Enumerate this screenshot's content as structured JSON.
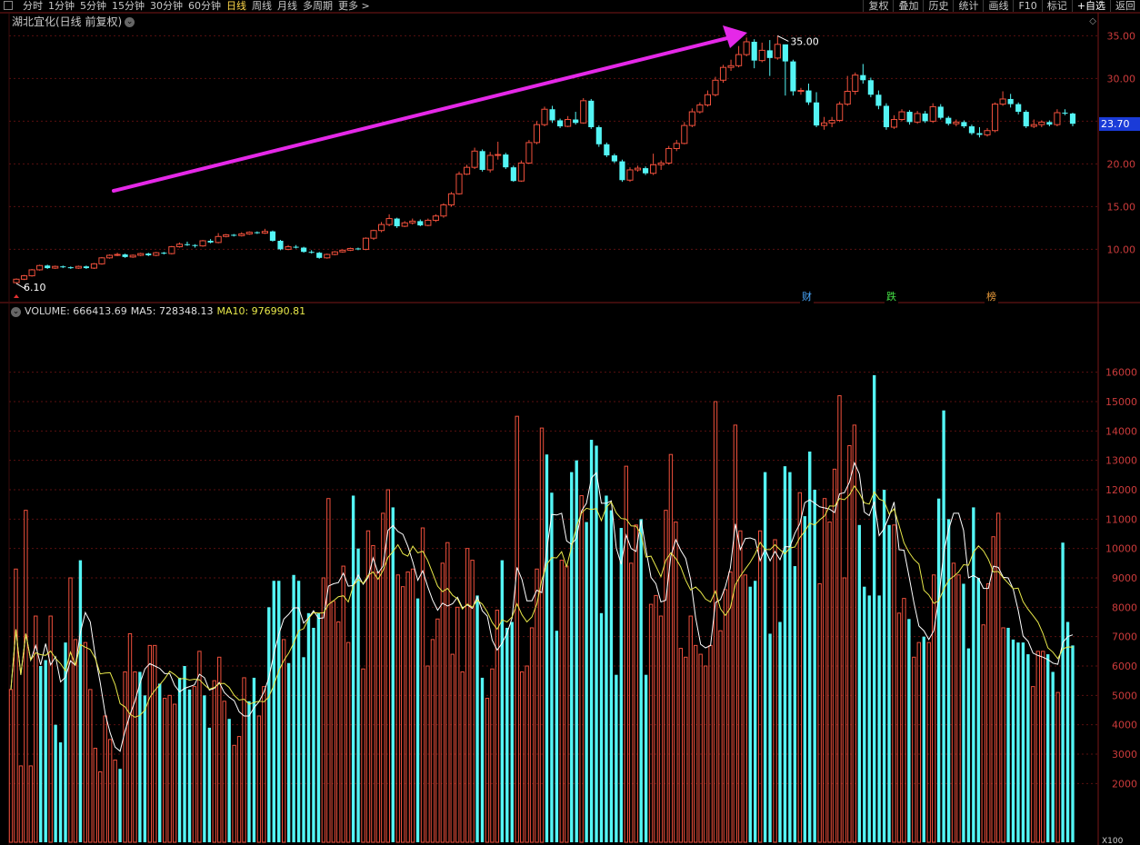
{
  "toolbar": {
    "periods": [
      "分时",
      "1分钟",
      "5分钟",
      "15分钟",
      "30分钟",
      "60分钟",
      "日线",
      "周线",
      "月线",
      "多周期",
      "更多 >"
    ],
    "active_period": "日线",
    "actions": [
      "复权",
      "叠加",
      "历史",
      "统计",
      "画线",
      "F10",
      "标记",
      "+自选",
      "返回"
    ],
    "highlight_action": "+自选"
  },
  "chart_title": "湖北宜化(日线 前复权)",
  "price_axis": {
    "ticks": [
      "35.00",
      "30.00",
      "25.00",
      "20.00",
      "15.00",
      "10.00"
    ],
    "values": [
      35,
      30,
      25,
      20,
      15,
      10
    ]
  },
  "volume_axis": {
    "ticks": [
      "16000",
      "15000",
      "14000",
      "13000",
      "12000",
      "11000",
      "10000",
      "9000",
      "8000",
      "7000",
      "6000",
      "5000",
      "4000",
      "3000",
      "2000"
    ],
    "values": [
      16000,
      15000,
      14000,
      13000,
      12000,
      11000,
      10000,
      9000,
      8000,
      7000,
      6000,
      5000,
      4000,
      3000,
      2000
    ],
    "unit_label": "X100"
  },
  "volume_header": {
    "volume": "VOLUME: 666413.69",
    "ma5": "MA5: 728348.13",
    "ma10": "MA10: 976990.81"
  },
  "last_price": "23.70",
  "high_label": "35.00",
  "low_label": "6.10",
  "events": [
    {
      "label": "财",
      "color": "#4aa8ff"
    },
    {
      "label": "跌",
      "color": "#45e045"
    },
    {
      "label": "榜",
      "color": "#e89a3a"
    }
  ],
  "colors": {
    "up": "#f0503c",
    "down": "#54f5f5",
    "ma5": "#ffffff",
    "ma10": "#e8e84a",
    "grid": "#5a1010",
    "arrow": "#e528e8",
    "axis_text": "#cc3b3b"
  },
  "chart_data": [
    {
      "type": "candlestick",
      "ylim": [
        6,
        36
      ],
      "candles": [
        [
          6.1,
          6.5,
          6.0,
          6.6
        ],
        [
          6.5,
          6.9,
          6.4,
          7.0
        ],
        [
          6.9,
          7.6,
          6.8,
          7.7
        ],
        [
          7.6,
          8.1,
          7.5,
          8.2
        ],
        [
          8.1,
          7.8,
          7.7,
          8.2
        ],
        [
          7.8,
          8.0,
          7.7,
          8.1
        ],
        [
          8.0,
          7.9,
          7.8,
          8.1
        ],
        [
          7.9,
          7.8,
          7.7,
          8.0
        ],
        [
          7.8,
          8.0,
          7.7,
          8.1
        ],
        [
          8.0,
          7.8,
          7.7,
          8.1
        ],
        [
          7.8,
          8.3,
          7.7,
          8.4
        ],
        [
          8.3,
          9.0,
          8.2,
          9.1
        ],
        [
          9.0,
          9.3,
          8.9,
          9.4
        ],
        [
          9.3,
          9.4,
          9.2,
          9.6
        ],
        [
          9.4,
          9.1,
          9.0,
          9.5
        ],
        [
          9.1,
          9.3,
          9.0,
          9.4
        ],
        [
          9.3,
          9.5,
          9.2,
          9.6
        ],
        [
          9.5,
          9.3,
          9.2,
          9.6
        ],
        [
          9.3,
          9.6,
          9.2,
          9.7
        ],
        [
          9.6,
          9.5,
          9.4,
          9.7
        ],
        [
          9.5,
          10.3,
          9.4,
          10.4
        ],
        [
          10.3,
          10.6,
          10.2,
          10.8
        ],
        [
          10.6,
          10.5,
          10.4,
          10.9
        ],
        [
          10.5,
          10.4,
          10.2,
          10.6
        ],
        [
          10.4,
          11.0,
          10.3,
          11.1
        ],
        [
          11.0,
          10.8,
          10.7,
          11.2
        ],
        [
          10.8,
          11.5,
          10.7,
          11.9
        ],
        [
          11.5,
          11.7,
          11.4,
          11.8
        ],
        [
          11.7,
          11.6,
          11.5,
          11.8
        ],
        [
          11.6,
          11.8,
          11.5,
          12.0
        ],
        [
          11.8,
          12.0,
          11.7,
          12.1
        ],
        [
          12.0,
          11.9,
          11.8,
          12.1
        ],
        [
          11.9,
          12.1,
          11.8,
          12.4
        ],
        [
          12.1,
          11.0,
          10.9,
          12.2
        ],
        [
          11.0,
          10.0,
          9.9,
          11.1
        ],
        [
          10.0,
          10.3,
          9.9,
          10.5
        ],
        [
          10.3,
          10.2,
          10.1,
          10.5
        ],
        [
          10.2,
          9.7,
          9.6,
          10.3
        ],
        [
          9.7,
          9.6,
          9.5,
          9.9
        ],
        [
          9.6,
          9.0,
          8.9,
          9.7
        ],
        [
          9.0,
          9.4,
          8.9,
          9.5
        ],
        [
          9.4,
          9.7,
          9.3,
          9.8
        ],
        [
          9.7,
          9.9,
          9.6,
          10.0
        ],
        [
          9.9,
          10.1,
          9.8,
          10.2
        ],
        [
          10.1,
          10.0,
          9.9,
          10.2
        ],
        [
          10.0,
          11.3,
          9.9,
          11.4
        ],
        [
          11.3,
          12.2,
          11.1,
          12.3
        ],
        [
          12.2,
          12.9,
          12.0,
          13.2
        ],
        [
          12.9,
          13.6,
          12.7,
          14.1
        ],
        [
          13.6,
          12.7,
          12.5,
          13.7
        ],
        [
          12.7,
          13.1,
          12.6,
          13.3
        ],
        [
          13.1,
          13.3,
          12.9,
          13.6
        ],
        [
          13.3,
          12.8,
          12.7,
          13.5
        ],
        [
          12.8,
          13.4,
          12.7,
          13.6
        ],
        [
          13.4,
          13.9,
          13.2,
          14.1
        ],
        [
          13.9,
          15.2,
          13.7,
          15.4
        ],
        [
          15.2,
          16.5,
          15.0,
          16.7
        ],
        [
          16.5,
          18.8,
          16.4,
          19.1
        ],
        [
          18.8,
          19.6,
          18.7,
          19.9
        ],
        [
          19.6,
          21.5,
          19.4,
          21.9
        ],
        [
          21.5,
          19.3,
          19.1,
          21.7
        ],
        [
          19.3,
          21.0,
          19.0,
          21.4
        ],
        [
          21.0,
          21.1,
          20.5,
          22.6
        ],
        [
          21.1,
          19.6,
          19.4,
          21.3
        ],
        [
          19.6,
          18.0,
          17.9,
          19.8
        ],
        [
          18.0,
          20.1,
          17.9,
          20.4
        ],
        [
          20.1,
          22.5,
          20.0,
          22.8
        ],
        [
          22.5,
          24.6,
          22.3,
          25.0
        ],
        [
          24.6,
          26.4,
          24.4,
          26.7
        ],
        [
          26.4,
          25.1,
          24.8,
          26.8
        ],
        [
          25.1,
          24.4,
          24.2,
          25.3
        ],
        [
          24.4,
          25.2,
          24.3,
          25.6
        ],
        [
          25.2,
          24.8,
          24.6,
          26.1
        ],
        [
          24.8,
          27.4,
          24.7,
          27.7
        ],
        [
          27.4,
          24.3,
          24.1,
          27.6
        ],
        [
          24.3,
          22.3,
          22.0,
          24.5
        ],
        [
          22.3,
          21.0,
          20.8,
          22.5
        ],
        [
          21.0,
          20.3,
          20.1,
          21.2
        ],
        [
          20.3,
          18.1,
          17.9,
          20.5
        ],
        [
          18.1,
          19.3,
          17.9,
          19.6
        ],
        [
          19.3,
          19.5,
          19.1,
          19.8
        ],
        [
          19.5,
          18.9,
          18.7,
          19.7
        ],
        [
          18.9,
          19.9,
          18.7,
          21.2
        ],
        [
          19.9,
          20.1,
          19.3,
          20.4
        ],
        [
          20.1,
          21.8,
          19.9,
          22.1
        ],
        [
          21.8,
          22.4,
          21.5,
          22.8
        ],
        [
          22.4,
          24.5,
          22.3,
          24.9
        ],
        [
          24.5,
          26.1,
          24.3,
          26.5
        ],
        [
          26.1,
          26.9,
          25.9,
          27.2
        ],
        [
          26.9,
          28.1,
          26.7,
          28.6
        ],
        [
          28.1,
          29.8,
          27.9,
          30.2
        ],
        [
          29.8,
          31.3,
          29.5,
          31.6
        ],
        [
          31.3,
          31.5,
          30.9,
          32.2
        ],
        [
          31.5,
          32.8,
          31.3,
          33.8
        ],
        [
          32.8,
          34.3,
          32.6,
          34.8
        ],
        [
          34.3,
          32.1,
          31.2,
          34.6
        ],
        [
          32.1,
          33.3,
          31.9,
          34.2
        ],
        [
          33.3,
          32.4,
          30.3,
          34.5
        ],
        [
          32.4,
          34.0,
          32.2,
          35.0
        ],
        [
          34.0,
          32.0,
          28.0,
          32.2
        ],
        [
          32.0,
          28.5,
          28.0,
          32.2
        ],
        [
          28.5,
          28.6,
          28.1,
          28.9
        ],
        [
          28.6,
          27.2,
          26.9,
          29.4
        ],
        [
          27.2,
          24.5,
          24.3,
          28.4
        ],
        [
          24.5,
          24.8,
          24.0,
          25.5
        ],
        [
          24.8,
          25.1,
          24.3,
          25.5
        ],
        [
          25.1,
          27.0,
          24.9,
          27.3
        ],
        [
          27.0,
          28.5,
          26.8,
          30.3
        ],
        [
          28.5,
          30.4,
          28.1,
          30.7
        ],
        [
          30.4,
          29.8,
          29.4,
          31.7
        ],
        [
          29.8,
          28.1,
          27.8,
          30.1
        ],
        [
          28.1,
          26.8,
          26.4,
          28.6
        ],
        [
          26.8,
          24.3,
          24.0,
          27.1
        ],
        [
          24.3,
          25.2,
          24.1,
          25.7
        ],
        [
          25.2,
          26.1,
          25.0,
          26.4
        ],
        [
          26.1,
          24.9,
          24.6,
          26.3
        ],
        [
          24.9,
          25.9,
          24.7,
          26.2
        ],
        [
          25.9,
          25.0,
          24.8,
          26.2
        ],
        [
          25.0,
          26.7,
          24.8,
          27.1
        ],
        [
          26.7,
          25.4,
          25.2,
          27.0
        ],
        [
          25.4,
          24.7,
          24.5,
          25.6
        ],
        [
          24.7,
          24.9,
          24.4,
          25.2
        ],
        [
          24.9,
          24.4,
          24.2,
          25.1
        ],
        [
          24.4,
          23.6,
          23.4,
          24.6
        ],
        [
          23.6,
          23.4,
          23.1,
          24.3
        ],
        [
          23.4,
          23.9,
          23.2,
          24.2
        ],
        [
          23.9,
          27.0,
          23.7,
          27.2
        ],
        [
          27.0,
          27.6,
          26.8,
          28.5
        ],
        [
          27.6,
          27.0,
          26.6,
          28.2
        ],
        [
          27.0,
          26.1,
          25.8,
          27.2
        ],
        [
          26.1,
          24.4,
          24.2,
          26.3
        ],
        [
          24.4,
          24.6,
          24.2,
          25.2
        ],
        [
          24.6,
          24.9,
          24.3,
          25.1
        ],
        [
          24.9,
          24.6,
          24.4,
          25.1
        ],
        [
          24.6,
          26.0,
          24.4,
          26.4
        ],
        [
          26.0,
          25.9,
          25.7,
          26.4
        ],
        [
          25.9,
          24.7,
          24.4,
          26.0
        ]
      ]
    },
    {
      "type": "bar",
      "ylim": [
        0,
        18000
      ],
      "values": [
        5200,
        9300,
        2600,
        11300,
        2600,
        7700,
        6000,
        6200,
        7700,
        4000,
        3400,
        6800,
        9000,
        6900,
        9600,
        6800,
        5200,
        3200,
        2400,
        4300,
        3500,
        2800,
        2500,
        5800,
        7100,
        5800,
        5800,
        5000,
        6700,
        6700,
        5400,
        4900,
        5000,
        4700,
        5600,
        6000,
        5200,
        5300,
        6500,
        5000,
        3900,
        5500,
        6300,
        4800,
        4200,
        3300,
        3600,
        5600,
        4800,
        5600,
        4300,
        5300,
        8000,
        8900,
        8900,
        6900,
        6100,
        9100,
        8900,
        6300,
        7800,
        7300,
        7800,
        9000,
        11700,
        8200,
        7500,
        9400,
        6800,
        11800,
        10000,
        5900,
        10600,
        10100,
        9200,
        11200,
        12000,
        11400,
        9100,
        8700,
        9200,
        9300,
        8300,
        10700,
        6000,
        6900,
        7600,
        9500,
        10200,
        6400,
        8000,
        5800,
        10000,
        9600,
        8400,
        5600,
        4900,
        5900,
        7900,
        9600,
        7300,
        7500,
        14500,
        5800,
        6000,
        7300,
        9300,
        14100,
        13200,
        11900,
        7200,
        9600,
        9400,
        12600,
        13000,
        11800,
        10900,
        13700,
        13500,
        7800,
        11800,
        11300,
        5700,
        10700,
        12800,
        9500,
        10800,
        11000,
        5700,
        8100,
        8400,
        7700,
        11300,
        13200,
        10900,
        6600,
        6300,
        7700,
        6700,
        6400,
        6000,
        6700,
        15000,
        7200,
        8600,
        9200,
        14200,
        10600,
        9100,
        8700,
        8900,
        10600,
        12600,
        7100,
        10300,
        7500,
        12800,
        12600,
        9400,
        11900,
        11100,
        13300,
        12000,
        8800,
        11700,
        10900,
        12700,
        15200,
        9000,
        13500,
        14200,
        10800,
        8700,
        8400,
        15900,
        8400,
        12000,
        10800,
        10800,
        7800,
        8300,
        7600,
        6300,
        6800,
        7000,
        6800,
        9100,
        11700,
        14700,
        11000,
        9500,
        9100,
        8800,
        6600,
        11400,
        9000,
        7400,
        8800,
        10400,
        11200,
        7300,
        7300,
        6900,
        6800,
        6800,
        6400,
        5300,
        6500,
        6500,
        6400,
        5800,
        5100,
        10200,
        7500,
        6700
      ],
      "up": []
    }
  ]
}
